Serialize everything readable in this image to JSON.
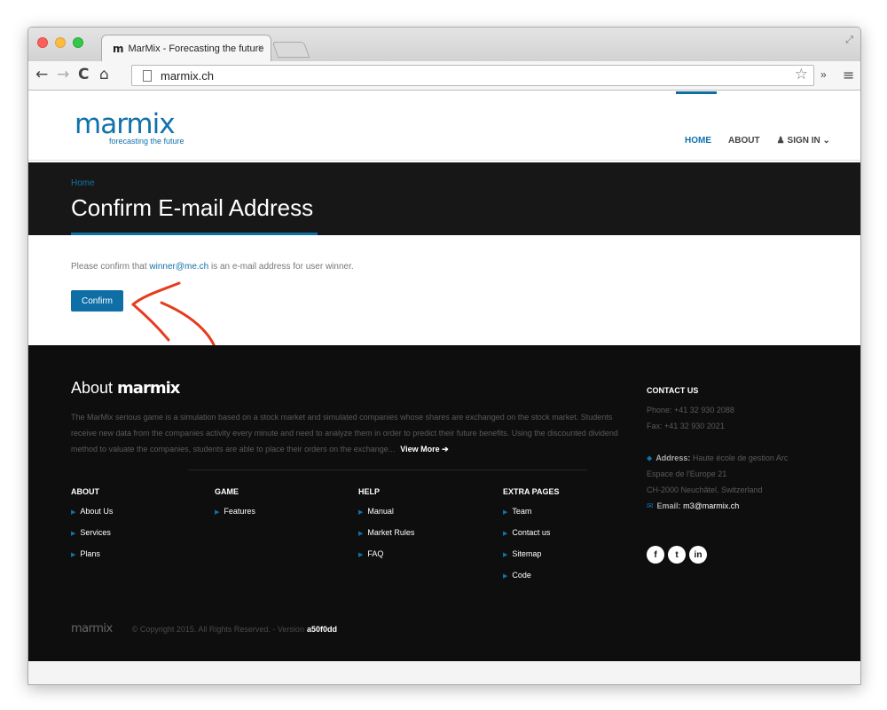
{
  "browser": {
    "tab_title": "MarMix - Forecasting the future",
    "tab_favicon": "m",
    "tab_close": "×",
    "url": "marmix.ch",
    "more": "»"
  },
  "header": {
    "logo_text": "marmix",
    "logo_tagline": "forecasting the future",
    "nav": {
      "home": "HOME",
      "about": "ABOUT",
      "sign_in": "SIGN IN"
    }
  },
  "banner": {
    "breadcrumb": "Home",
    "title": "Confirm E-mail Address"
  },
  "content": {
    "text_before": "Please confirm that ",
    "email": "winner@me.ch",
    "text_after": " is an e-mail address for user winner.",
    "confirm_label": "Confirm"
  },
  "footer": {
    "about_title": "About ",
    "about_brand": "marmix",
    "about_text": "The MarMix serious game is a simulation based on a stock market and simulated companies whose shares are exchanged on the stock market. Students receive new data from the companies activity every minute and need to analyze them in order to predict their future benefits. Using the discounted dividend method to valuate the companies, students are able to place their orders on the exchange...",
    "view_more": "View More",
    "columns": [
      {
        "title": "ABOUT",
        "items": [
          "About Us",
          "Services",
          "Plans"
        ]
      },
      {
        "title": "GAME",
        "items": [
          "Features"
        ]
      },
      {
        "title": "HELP",
        "items": [
          "Manual",
          "Market Rules",
          "FAQ"
        ]
      },
      {
        "title": "EXTRA PAGES",
        "items": [
          "Team",
          "Contact us",
          "Sitemap",
          "Code"
        ]
      }
    ],
    "contact": {
      "title": "CONTACT US",
      "phone": "Phone: +41 32 930 2088",
      "fax": "Fax: +41 32 930 2021",
      "address_label": "Address:",
      "address_line1": "Haute école de gestion Arc",
      "address_line2": "Espace de l'Europe 21",
      "address_line3": "CH-2000 Neuchâtel, Switzerland",
      "email_label": "Email:",
      "email": "m3@marmix.ch"
    },
    "socials": [
      "f",
      "t",
      "in"
    ],
    "bottom_logo": "marmix",
    "copyright": "© Copyright 2015. All Rights Reserved. - Version",
    "version": "a50f0dd"
  },
  "colors": {
    "accent": "#1172ab",
    "annotation_arrow": "#e63c1e"
  }
}
